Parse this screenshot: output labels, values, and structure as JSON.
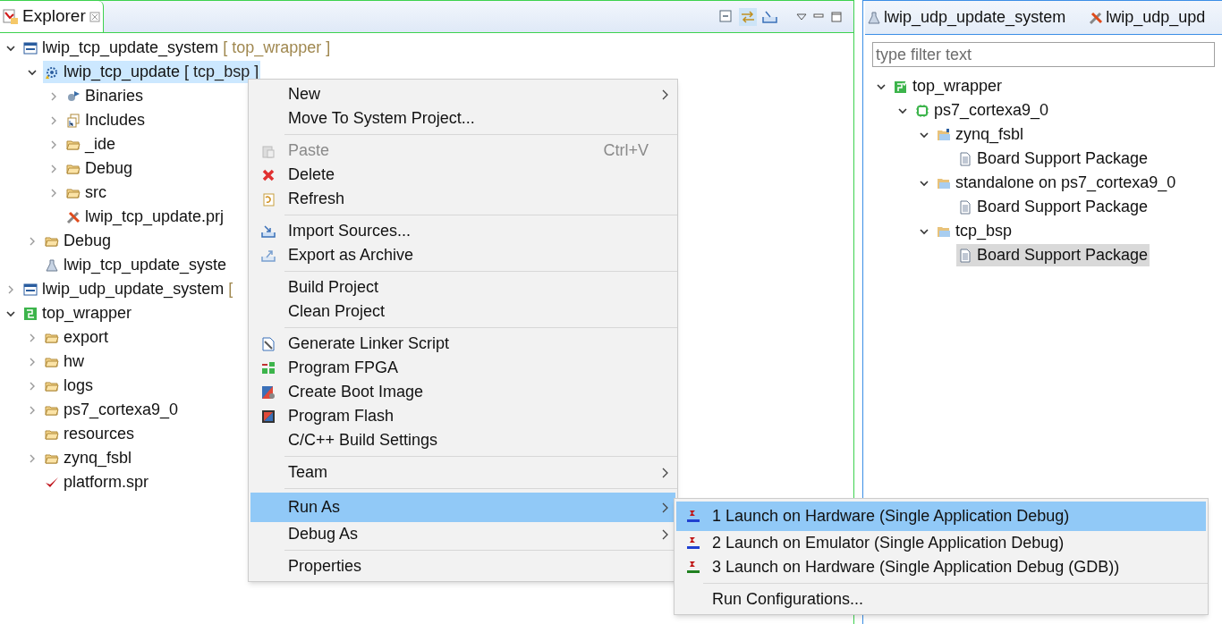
{
  "explorer": {
    "title": "Explorer"
  },
  "left_tree": [
    {
      "label": "lwip_tcp_update_system",
      "suffix": "[ top_wrapper ]",
      "kind": "system",
      "expanded": true,
      "selected": false,
      "children": [
        {
          "label": "lwip_tcp_update",
          "suffix": "[ tcp_bsp ]",
          "kind": "app",
          "expanded": true,
          "selected": true,
          "children": [
            {
              "label": "Binaries",
              "kind": "binaries",
              "expanded": false,
              "selected": false
            },
            {
              "label": "Includes",
              "kind": "includes",
              "expanded": false,
              "selected": false
            },
            {
              "label": "_ide",
              "kind": "folder",
              "expanded": false,
              "selected": false
            },
            {
              "label": "Debug",
              "kind": "folder",
              "expanded": false,
              "selected": false
            },
            {
              "label": "src",
              "kind": "srcfolder",
              "expanded": false,
              "selected": false
            },
            {
              "label": "lwip_tcp_update.prj",
              "kind": "prj",
              "selected": false
            }
          ]
        },
        {
          "label": "Debug",
          "kind": "folder",
          "expanded": false,
          "selected": false
        },
        {
          "label": "lwip_tcp_update_syste",
          "kind": "launch",
          "selected": false
        }
      ]
    },
    {
      "label": "lwip_udp_update_system",
      "suffix": "[",
      "kind": "system",
      "expanded": false,
      "selected": false
    },
    {
      "label": "top_wrapper",
      "kind": "hw",
      "expanded": true,
      "selected": false,
      "children": [
        {
          "label": "export",
          "kind": "folder",
          "expanded": false,
          "selected": false
        },
        {
          "label": "hw",
          "kind": "folder",
          "expanded": false,
          "selected": false
        },
        {
          "label": "logs",
          "kind": "folder",
          "expanded": false,
          "selected": false
        },
        {
          "label": "ps7_cortexa9_0",
          "kind": "folder",
          "expanded": false,
          "selected": false
        },
        {
          "label": "resources",
          "kind": "folder",
          "selected": false
        },
        {
          "label": "zynq_fsbl",
          "kind": "folder",
          "expanded": false,
          "selected": false
        },
        {
          "label": "platform.spr",
          "kind": "platform",
          "selected": false
        }
      ]
    }
  ],
  "context_menu": {
    "groups": [
      [
        {
          "label": "New",
          "kind": "plain",
          "submenu": true,
          "disabled": false,
          "selected": false
        },
        {
          "label": "Move To System Project...",
          "kind": "plain",
          "submenu": false,
          "disabled": false,
          "selected": false
        }
      ],
      [
        {
          "label": "Paste",
          "shortcut": "Ctrl+V",
          "kind": "paste",
          "submenu": false,
          "disabled": true,
          "selected": false
        },
        {
          "label": "Delete",
          "kind": "delete",
          "submenu": false,
          "disabled": false,
          "selected": false
        },
        {
          "label": "Refresh",
          "kind": "refresh",
          "submenu": false,
          "disabled": false,
          "selected": false
        }
      ],
      [
        {
          "label": "Import Sources...",
          "kind": "import",
          "submenu": false,
          "disabled": false,
          "selected": false
        },
        {
          "label": "Export as Archive",
          "kind": "export",
          "submenu": false,
          "disabled": false,
          "selected": false
        }
      ],
      [
        {
          "label": "Build Project",
          "kind": "plain",
          "submenu": false,
          "disabled": false,
          "selected": false
        },
        {
          "label": "Clean Project",
          "kind": "plain",
          "submenu": false,
          "disabled": false,
          "selected": false
        }
      ],
      [
        {
          "label": "Generate Linker Script",
          "kind": "linker",
          "submenu": false,
          "disabled": false,
          "selected": false
        },
        {
          "label": "Program FPGA",
          "kind": "fpga",
          "submenu": false,
          "disabled": false,
          "selected": false
        },
        {
          "label": "Create Boot Image",
          "kind": "boot",
          "submenu": false,
          "disabled": false,
          "selected": false
        },
        {
          "label": "Program Flash",
          "kind": "flash",
          "submenu": false,
          "disabled": false,
          "selected": false
        },
        {
          "label": "C/C++ Build Settings",
          "kind": "plain",
          "submenu": false,
          "disabled": false,
          "selected": false
        }
      ],
      [
        {
          "label": "Team",
          "kind": "plain",
          "submenu": true,
          "disabled": false,
          "selected": false
        }
      ],
      [
        {
          "label": "Run As",
          "kind": "plain",
          "submenu": true,
          "disabled": false,
          "selected": true
        },
        {
          "label": "Debug As",
          "kind": "plain",
          "submenu": true,
          "disabled": false,
          "selected": false
        }
      ],
      [
        {
          "label": "Properties",
          "kind": "plain",
          "submenu": false,
          "disabled": false,
          "selected": false
        }
      ]
    ]
  },
  "run_as_submenu": {
    "groups": [
      [
        {
          "label": "1 Launch on Hardware (Single Application Debug)",
          "kind": "tcf",
          "selected": true
        },
        {
          "label": "2 Launch on Emulator (Single Application Debug)",
          "kind": "tcf",
          "selected": false
        },
        {
          "label": "3 Launch on Hardware (Single Application Debug (GDB))",
          "kind": "gdb",
          "selected": false
        }
      ],
      [
        {
          "label": "Run Configurations...",
          "kind": "plain",
          "selected": false
        }
      ]
    ]
  },
  "right_panel": {
    "tabs": [
      {
        "label": "lwip_udp_update_system",
        "kind": "launch"
      },
      {
        "label": "lwip_udp_upd",
        "kind": "prj"
      }
    ],
    "filter": {
      "placeholder": "type filter text"
    },
    "tree": [
      {
        "label": "top_wrapper",
        "kind": "hwcheck",
        "expanded": true,
        "selected": false,
        "children": [
          {
            "label": "ps7_cortexa9_0",
            "kind": "cpu",
            "expanded": true,
            "selected": false,
            "children": [
              {
                "label": "zynq_fsbl",
                "kind": "bspfolder",
                "expanded": true,
                "selected": false,
                "children": [
                  {
                    "label": "Board Support Package",
                    "kind": "doc",
                    "selected": false
                  }
                ]
              },
              {
                "label": "standalone on ps7_cortexa9_0",
                "kind": "bluefolder",
                "expanded": true,
                "selected": false,
                "children": [
                  {
                    "label": "Board Support Package",
                    "kind": "doc",
                    "selected": false
                  }
                ]
              },
              {
                "label": "tcp_bsp",
                "kind": "bluefolder",
                "expanded": true,
                "selected": false,
                "children": [
                  {
                    "label": "Board Support Package",
                    "kind": "doc",
                    "selected": true
                  }
                ]
              }
            ]
          }
        ]
      }
    ]
  }
}
